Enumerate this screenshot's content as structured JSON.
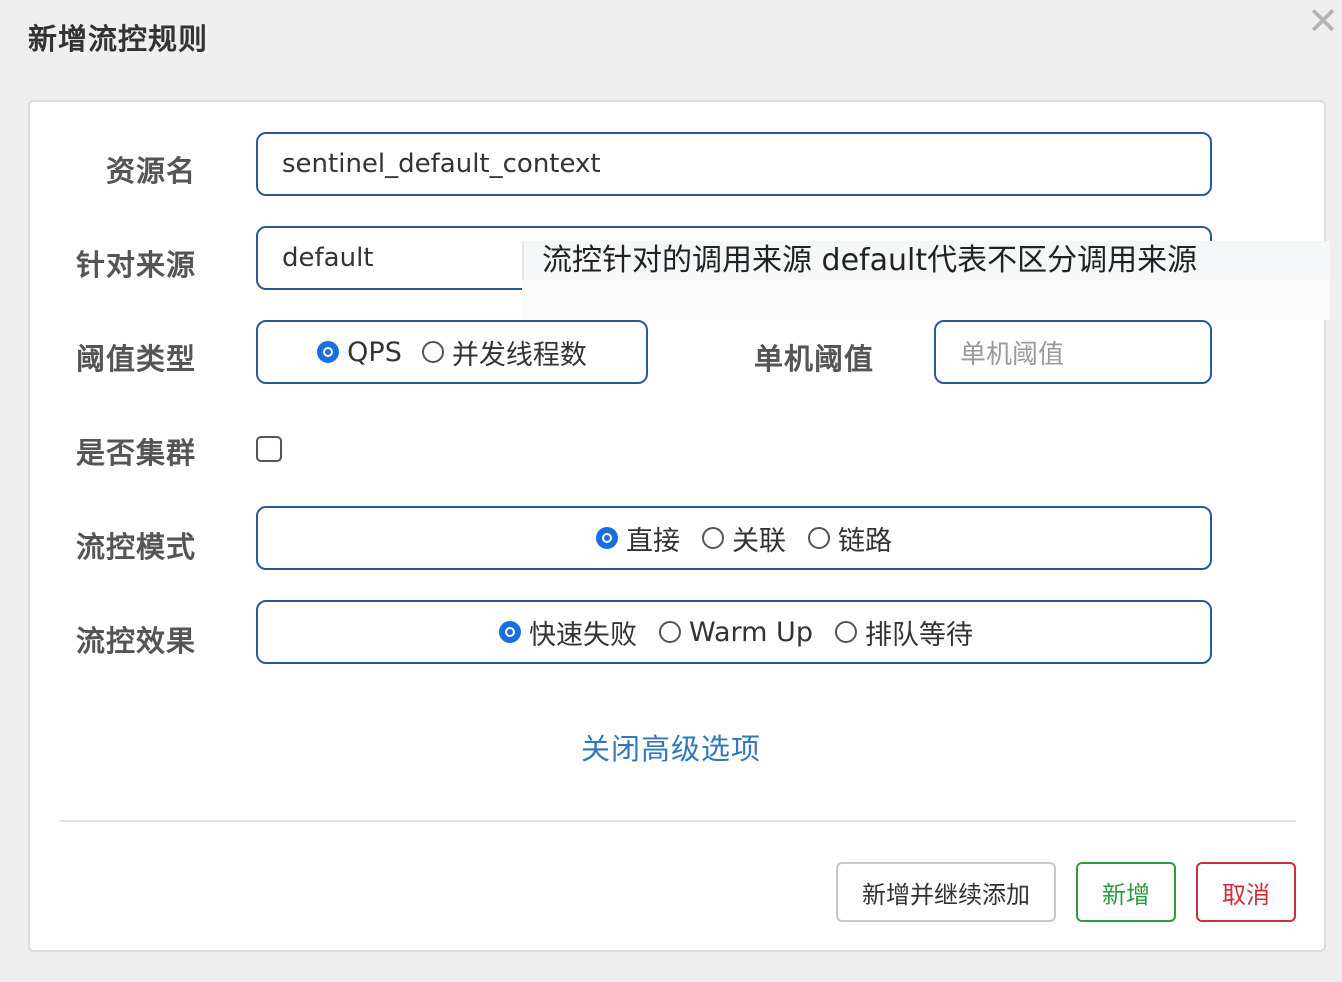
{
  "dialog": {
    "title": "新增流控规则",
    "close_icon": "close-icon"
  },
  "form": {
    "resource_name": {
      "label": "资源名",
      "value": "sentinel_default_context"
    },
    "limit_app": {
      "label": "针对来源",
      "value": "default",
      "tooltip": "流控针对的调用来源 default代表不区分调用来源"
    },
    "threshold_type": {
      "label": "阈值类型",
      "options": [
        "QPS",
        "并发线程数"
      ],
      "selected": "QPS"
    },
    "single_threshold": {
      "label": "单机阈值",
      "placeholder": "单机阈值",
      "value": ""
    },
    "cluster_mode": {
      "label": "是否集群",
      "checked": false
    },
    "control_mode": {
      "label": "流控模式",
      "options": [
        "直接",
        "关联",
        "链路"
      ],
      "selected": "直接"
    },
    "control_effect": {
      "label": "流控效果",
      "options": [
        "快速失败",
        "Warm Up",
        "排队等待"
      ],
      "selected": "快速失败"
    }
  },
  "advanced_link": "关闭高级选项",
  "buttons": {
    "add_and_continue": "新增并继续添加",
    "add": "新增",
    "cancel": "取消"
  },
  "colors": {
    "input_border": "#2a5a96",
    "radio_selected": "#1a6fe0",
    "link": "#3278be",
    "add_button": "#2f9a41",
    "cancel_button": "#cf2e3a"
  }
}
